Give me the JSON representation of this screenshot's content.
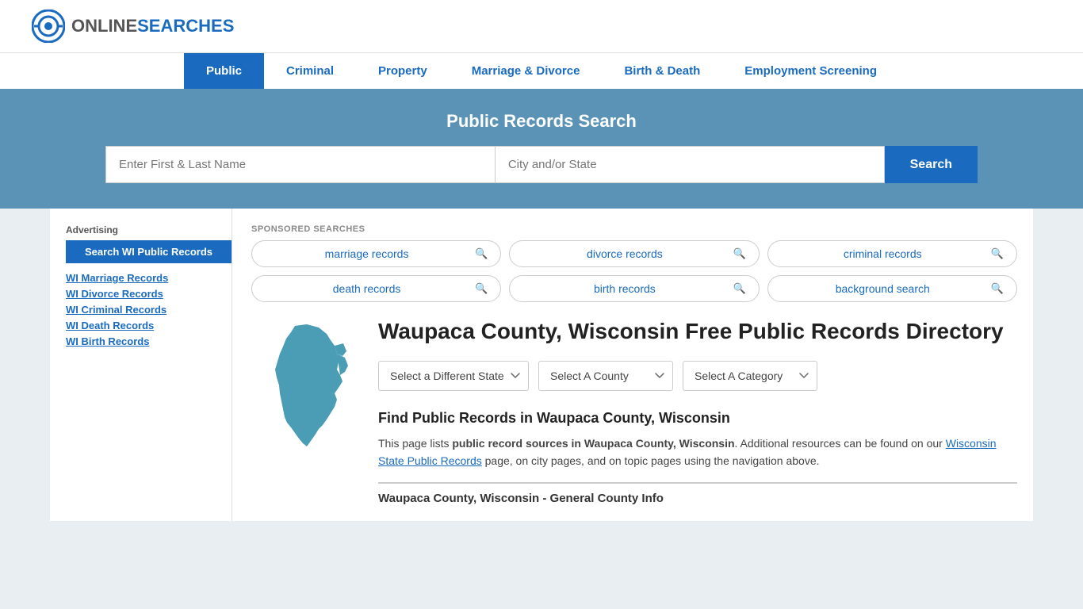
{
  "header": {
    "logo_online": "ONLINE",
    "logo_searches": "SEARCHES"
  },
  "nav": {
    "items": [
      {
        "label": "Public",
        "active": true
      },
      {
        "label": "Criminal",
        "active": false
      },
      {
        "label": "Property",
        "active": false
      },
      {
        "label": "Marriage & Divorce",
        "active": false
      },
      {
        "label": "Birth & Death",
        "active": false
      },
      {
        "label": "Employment Screening",
        "active": false
      }
    ]
  },
  "search_banner": {
    "title": "Public Records Search",
    "name_placeholder": "Enter First & Last Name",
    "location_placeholder": "City and/or State",
    "button_label": "Search"
  },
  "sponsored": {
    "label": "SPONSORED SEARCHES",
    "items": [
      {
        "text": "marriage records"
      },
      {
        "text": "divorce records"
      },
      {
        "text": "criminal records"
      },
      {
        "text": "death records"
      },
      {
        "text": "birth records"
      },
      {
        "text": "background search"
      }
    ]
  },
  "county": {
    "title": "Waupaca County, Wisconsin Free Public Records Directory",
    "dropdowns": {
      "state": "Select a Different State",
      "county": "Select A County",
      "category": "Select A Category"
    },
    "find_title": "Find Public Records in Waupaca County, Wisconsin",
    "find_desc_part1": "This page lists ",
    "find_desc_bold": "public record sources in Waupaca County, Wisconsin",
    "find_desc_part2": ". Additional resources can be found on our ",
    "find_link_text": "Wisconsin State Public Records",
    "find_desc_part3": " page, on city pages, and on topic pages using the navigation above.",
    "general_info": "Waupaca County, Wisconsin - General County Info"
  },
  "sidebar": {
    "advertising_label": "Advertising",
    "ad_button": "Search WI Public Records",
    "links": [
      "WI Marriage Records",
      "WI Divorce Records",
      "WI Criminal Records",
      "WI Death Records",
      "WI Birth Records"
    ]
  }
}
